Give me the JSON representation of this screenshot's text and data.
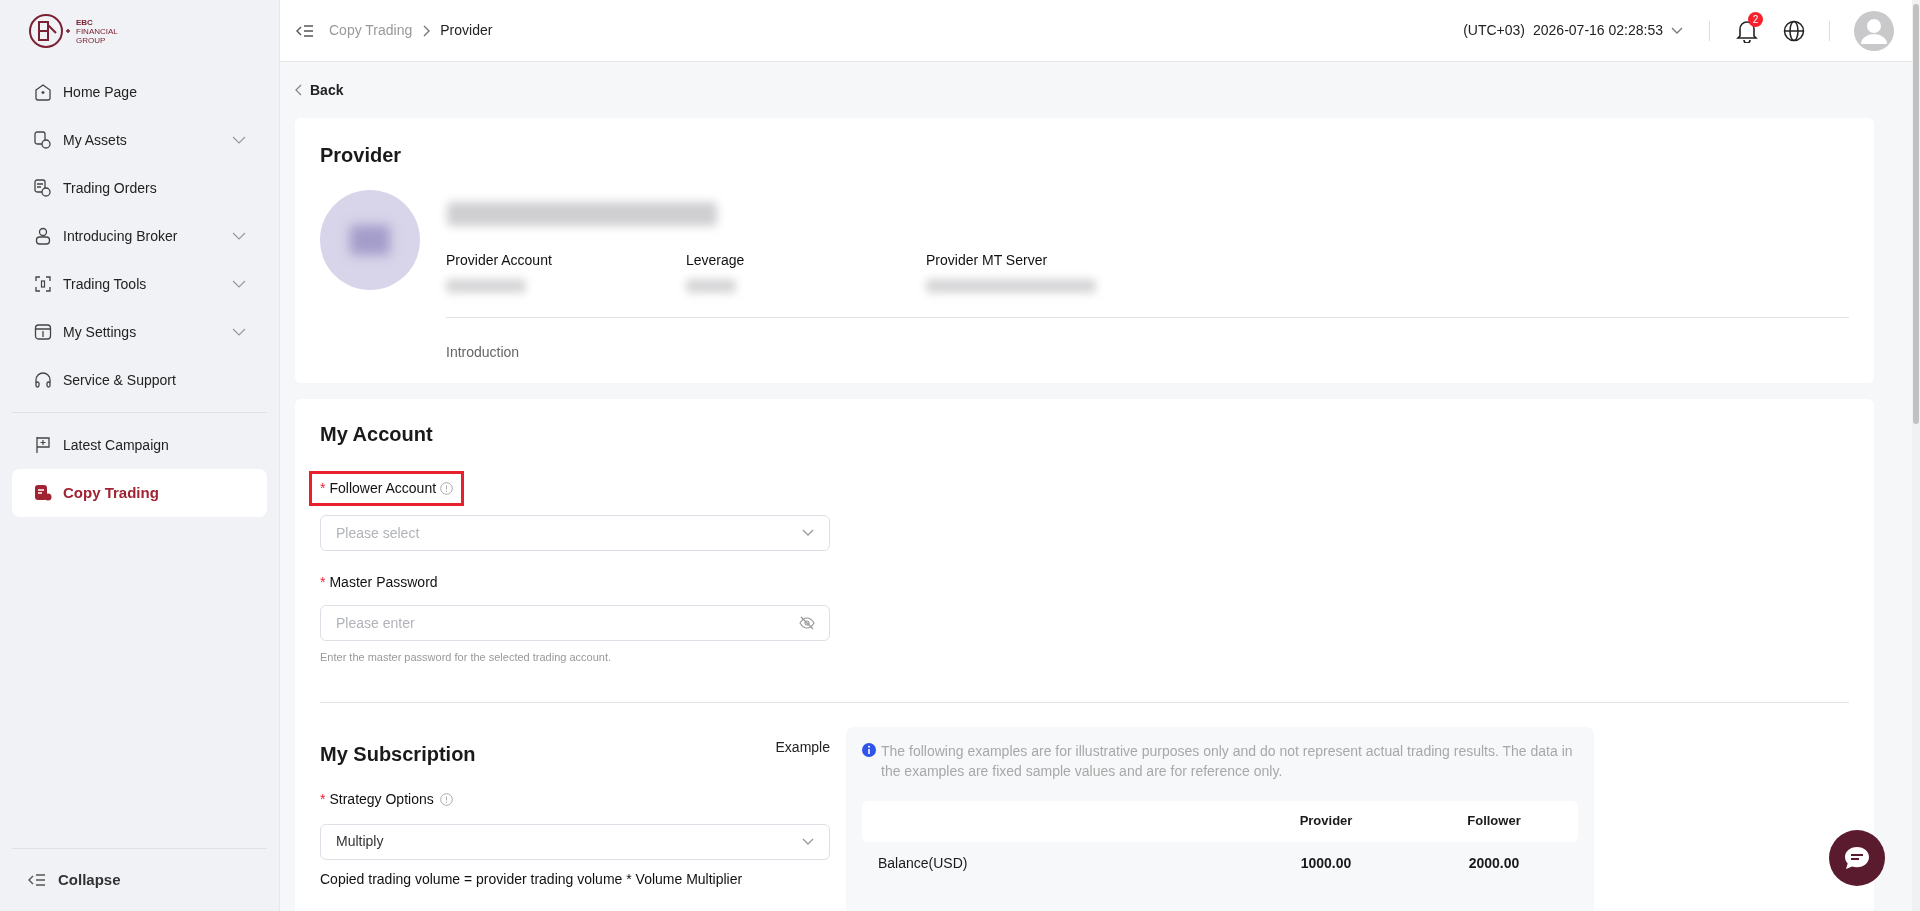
{
  "logo": {
    "line_1": "EBC",
    "line_2": "FINANCIAL",
    "line_3": "GROUP"
  },
  "sidebar": {
    "items": [
      {
        "label": "Home Page",
        "expandable": false,
        "selected": false
      },
      {
        "label": "My Assets",
        "expandable": true,
        "selected": false
      },
      {
        "label": "Trading Orders",
        "expandable": false,
        "selected": false
      },
      {
        "label": "Introducing Broker",
        "expandable": true,
        "selected": false
      },
      {
        "label": "Trading Tools",
        "expandable": true,
        "selected": false
      },
      {
        "label": "My Settings",
        "expandable": true,
        "selected": false
      },
      {
        "label": "Service & Support",
        "expandable": false,
        "selected": false
      },
      {
        "label": "Latest Campaign",
        "expandable": false,
        "selected": false
      },
      {
        "label": "Copy Trading",
        "expandable": false,
        "selected": true
      }
    ],
    "collapse": "Collapse"
  },
  "header": {
    "breadcrumb": [
      "Copy Trading",
      "Provider"
    ],
    "timezone": "(UTC+03)",
    "datetime": "2026-07-16 02:28:53",
    "notifications": "2"
  },
  "back": "Back",
  "provider": {
    "title": "Provider",
    "fields": [
      {
        "label": "Provider Account"
      },
      {
        "label": "Leverage"
      },
      {
        "label": "Provider MT Server"
      }
    ],
    "introduction": "Introduction"
  },
  "my_account": {
    "title": "My Account",
    "follower_account": {
      "label": "Follower Account",
      "required_mark": "*",
      "highlighted": true,
      "placeholder": "Please select"
    },
    "master_password": {
      "label": "Master Password",
      "required_mark": "*",
      "placeholder": "Please enter",
      "hint": "Enter the master password for the selected trading account."
    }
  },
  "my_subscription": {
    "title": "My Subscription",
    "example": "Example",
    "strategy": {
      "label": "Strategy Options",
      "required_mark": "*",
      "value": "Multiply"
    },
    "formula": "Copied trading volume = provider trading volume * Volume Multiplier"
  },
  "example_panel": {
    "notice": "The following examples are for illustrative purposes only and do not represent actual trading results. The data in the examples are fixed sample values and are for reference only.",
    "columns": [
      "Provider",
      "Follower"
    ],
    "rows": [
      {
        "label": "Balance(USD)",
        "provider": "1000.00",
        "follower": "2000.00"
      }
    ]
  }
}
